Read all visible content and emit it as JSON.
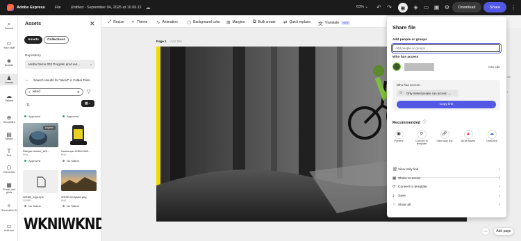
{
  "topbar": {
    "app_name": "Adobe Express",
    "file_menu": "File",
    "doc_title": "Untitled - September 04, 2025 at 10.06.11",
    "zoom": "63%",
    "download_label": "Download",
    "share_label": "Share"
  },
  "rail": {
    "items": [
      {
        "label": "Search",
        "icon": "search-icon"
      },
      {
        "label": "Your stuff",
        "icon": "folder-icon"
      },
      {
        "label": "Brands",
        "icon": "brand-icon"
      },
      {
        "label": "Assets",
        "icon": "assets-icon"
      },
      {
        "label": "Upload",
        "icon": "upload-icon"
      },
      {
        "label": "Templates",
        "icon": "templates-icon"
      },
      {
        "label": "Media",
        "icon": "media-icon"
      },
      {
        "label": "Text",
        "icon": "text-icon"
      },
      {
        "label": "Elements",
        "icon": "elements-icon"
      },
      {
        "label": "Charts and grids",
        "icon": "chart-icon"
      },
      {
        "label": "Generative AI",
        "icon": "sparkle-icon"
      },
      {
        "label": "Add-ons",
        "icon": "addons-icon"
      }
    ]
  },
  "assets_panel": {
    "title": "Assets",
    "tab_assets": "Assets",
    "tab_collections": "Collections",
    "repository_label": "Repository",
    "repository_value": "Adobe Demo 002 Program prod aut...",
    "results_text": "Search results for \"wknd\" in Folder Files",
    "search_value": "wknd",
    "status_approved": "Approved",
    "status_none": "No Status",
    "expired_badge": "Expired",
    "items": [
      {
        "name": "Ranger-helmet_WK...",
        "type": "PNG",
        "status": "Approved"
      },
      {
        "name": "Kamloops-1280x1280...",
        "type": "PNG",
        "status": "No Status"
      },
      {
        "name": "WKND_logo.eps",
        "type": "OTHER",
        "status": "No Status"
      },
      {
        "name": "WKND template.png",
        "type": "PNG",
        "status": "No Status"
      }
    ],
    "wknd_text": "WKND"
  },
  "toolbar": {
    "resize": "Resize",
    "theme": "Theme",
    "animation": "Animation",
    "background_color": "Background color",
    "margins": "Margins",
    "bulk_create": "Bulk create",
    "quick_replace": "Quick replace",
    "translate": "Translate",
    "new_badge": "NEW"
  },
  "canvas": {
    "page_label": "Page 1",
    "page_title_placeholder": "- Add title",
    "add_page": "Add page"
  },
  "share_panel": {
    "title": "Share file",
    "add_label": "Add people or groups",
    "add_placeholder": "Add people or groups",
    "who_label": "Who has access",
    "can_edit": "Can edit",
    "access_title": "Who has access:",
    "access_value": "Only invited people can access",
    "copy_link": "Copy link",
    "recommended": "Recommended",
    "rec_items": [
      {
        "label": "Present",
        "icon": "present-icon"
      },
      {
        "label": "Convert to template",
        "icon": "convert-icon"
      },
      {
        "label": "View-only link",
        "icon": "link-icon"
      },
      {
        "label": "AEM Assets",
        "icon": "aem-icon"
      },
      {
        "label": "OneDrive",
        "icon": "cloud-icon"
      }
    ],
    "links": [
      {
        "label": "View-only link",
        "icon": "link-icon"
      },
      {
        "label": "Share to social",
        "icon": "social-icon"
      },
      {
        "label": "Convert to template",
        "icon": "convert-icon"
      },
      {
        "label": "Save",
        "icon": "save-icon"
      },
      {
        "label": "Show all",
        "icon": "grid-icon"
      }
    ]
  }
}
